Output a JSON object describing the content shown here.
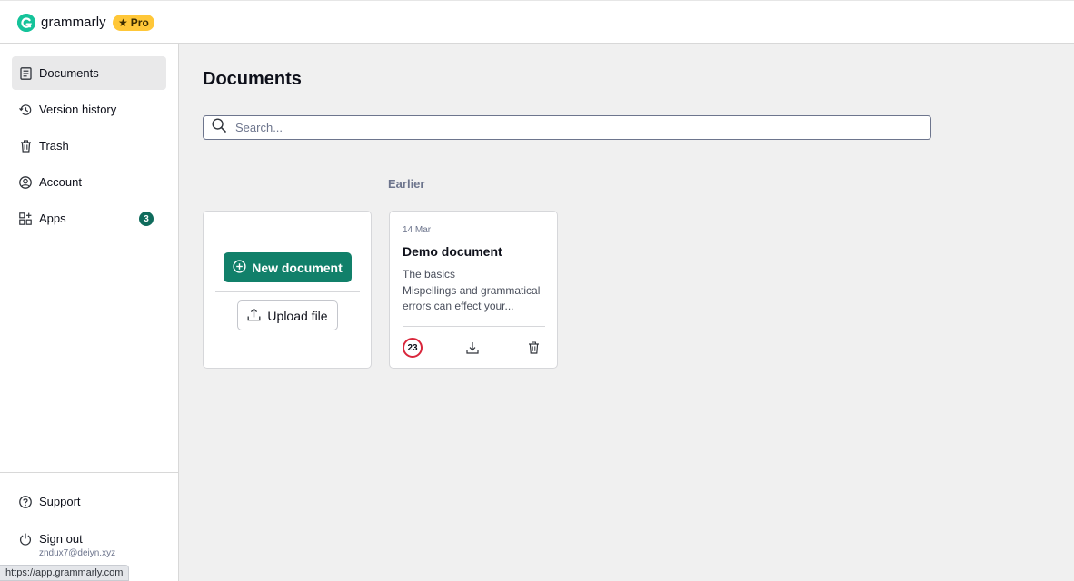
{
  "topbar": {
    "brand": "grammarly",
    "badge": "Pro",
    "logo_icon": "grammarly-g-logo",
    "accent_color": "#15c39a",
    "badge_color": "#ffc738"
  },
  "sidebar": {
    "items": [
      {
        "label": "Documents",
        "icon": "document-icon",
        "active": true
      },
      {
        "label": "Version history",
        "icon": "history-icon"
      },
      {
        "label": "Trash",
        "icon": "trash-icon"
      },
      {
        "label": "Account",
        "icon": "account-icon"
      },
      {
        "label": "Apps",
        "icon": "apps-icon",
        "badge": "3"
      }
    ],
    "bottom_items": [
      {
        "label": "Support",
        "icon": "help-icon"
      },
      {
        "label": "Sign out",
        "icon": "power-icon"
      }
    ],
    "user_email": "zndux7@deiyn.xyz",
    "badge_color": "#0f6b5c"
  },
  "main": {
    "title": "Documents",
    "search": {
      "placeholder": "Search...",
      "value": ""
    },
    "section_label": "Earlier",
    "new_card": {
      "new_label": "New document",
      "upload_label": "Upload file",
      "button_color": "#11806a"
    },
    "documents": [
      {
        "date": "14 Mar",
        "title": "Demo document",
        "excerpt_lines": [
          "The basics",
          "Mispellings and grammatical",
          "errors can effect your..."
        ],
        "score": "23",
        "score_color": "#d9263b",
        "actions": [
          "download-icon",
          "trash-icon"
        ]
      }
    ]
  },
  "status_bar": {
    "url": "https://app.grammarly.com"
  }
}
